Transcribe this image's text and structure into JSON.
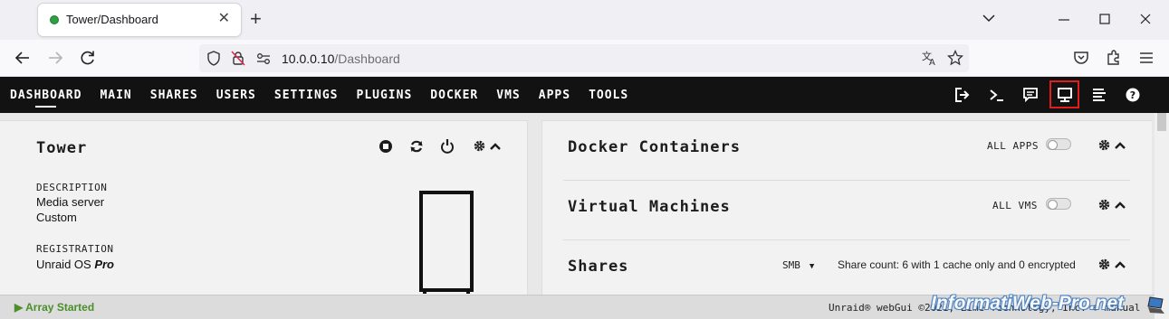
{
  "browser": {
    "tab_title": "Tower/Dashboard",
    "url_host": "10.0.0.10",
    "url_path": "/Dashboard",
    "close_glyph": "✕",
    "newtab_glyph": "+",
    "win_min": "—",
    "win_max": "☐",
    "win_close": "✕"
  },
  "menu": {
    "items": [
      "DASHBOARD",
      "MAIN",
      "SHARES",
      "USERS",
      "SETTINGS",
      "PLUGINS",
      "DOCKER",
      "VMS",
      "APPS",
      "TOOLS"
    ],
    "active": "DASHBOARD"
  },
  "header_icons": [
    "logout-icon",
    "terminal-icon",
    "feedback-icon",
    "monitor-icon",
    "log-icon",
    "help-icon"
  ],
  "highlight_color": "#e31c1c",
  "server": {
    "name": "Tower",
    "description_label": "DESCRIPTION",
    "description_line1": "Media server",
    "description_line2": "Custom",
    "registration_label": "REGISTRATION",
    "registration_value": "Unraid OS ",
    "registration_tier": "Pro"
  },
  "docker": {
    "title": "Docker Containers",
    "filter_label": "ALL APPS"
  },
  "vms": {
    "title": "Virtual Machines",
    "filter_label": "ALL VMS"
  },
  "shares": {
    "title": "Shares",
    "protocol": "SMB",
    "protocol_arrow": "▼",
    "summary": "Share count: 6 with 1 cache only and 0 encrypted"
  },
  "footer": {
    "status_icon": "▶",
    "status": "Array Started",
    "credit": "Unraid® webGui ©2021, Lime Technology, Inc. ⊕ manual"
  },
  "watermark": "InformatiWeb-Pro.net"
}
